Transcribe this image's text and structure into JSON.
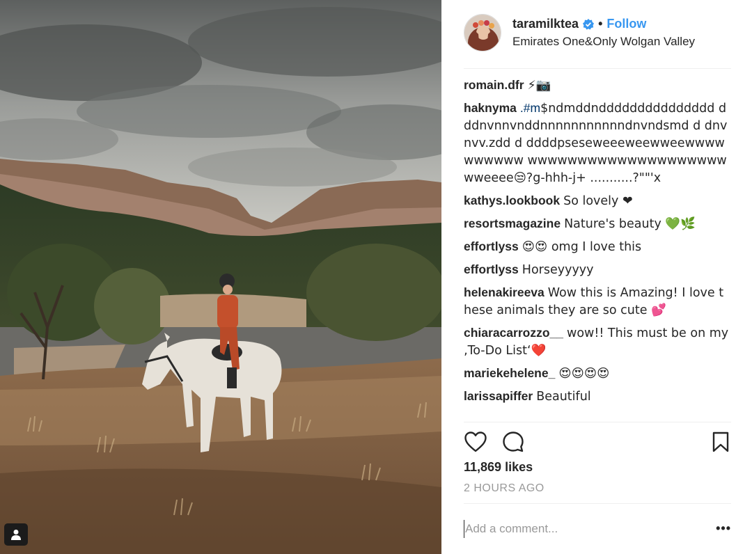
{
  "post": {
    "username": "taramilktea",
    "separator": "•",
    "follow_label": "Follow",
    "location": "Emirates One&Only Wolgan Valley",
    "accent_color": "#3897f0"
  },
  "comments": [
    {
      "author": "romain.dfr",
      "pre": "",
      "hashtag": "",
      "text": "⚡📷"
    },
    {
      "author": "haknyma",
      "pre": ".",
      "hashtag": "#m",
      "text": "$ndmddnddddddddddddddd dddnvnnvnddnnnnnnnnnnndnvndsmd d dnvnvv.zdd d ddddpseseweeeweewweewwwwwwwwww wwwwwwwwwwwwwwwwwwwwwweeee😒?g-hhh-j+ ...........?\"\"'x"
    },
    {
      "author": "kathys.lookbook",
      "pre": "",
      "hashtag": "",
      "text": "So lovely ❤"
    },
    {
      "author": "resortsmagazine",
      "pre": "",
      "hashtag": "",
      "text": "Nature's beauty 💚🌿"
    },
    {
      "author": "effortlyss",
      "pre": "",
      "hashtag": "",
      "text": "😍😍 omg I love this"
    },
    {
      "author": "effortlyss",
      "pre": "",
      "hashtag": "",
      "text": "Horseyyyyy"
    },
    {
      "author": "helenakireeva",
      "pre": "",
      "hashtag": "",
      "text": "Wow this is Amazing! I love these animals they are so cute 💕"
    },
    {
      "author": "chiaracarrozzo__",
      "pre": "",
      "hashtag": "",
      "text": "wow!! This must be on my ‚To-Do List‘❤️"
    },
    {
      "author": "mariekehelene_",
      "pre": "",
      "hashtag": "",
      "text": "😍😍😍😍"
    },
    {
      "author": "larissapiffer",
      "pre": "",
      "hashtag": "",
      "text": "Beautiful"
    }
  ],
  "stats": {
    "likes": "11,869 likes",
    "time": "2 HOURS AGO"
  },
  "composer": {
    "placeholder": "Add a comment...",
    "more": "•••"
  },
  "icons": {
    "like": "heart-icon",
    "comment": "comment-bubble-icon",
    "save": "bookmark-icon",
    "verified": "verified-badge-icon",
    "tagged": "tagged-user-icon"
  }
}
